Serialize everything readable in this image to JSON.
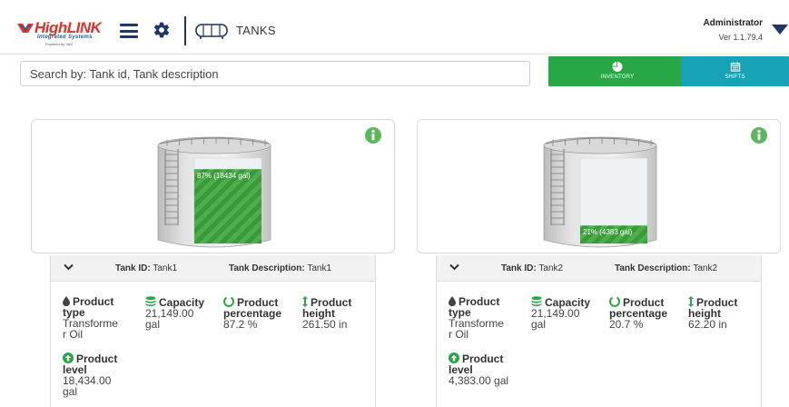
{
  "header": {
    "logo_text": "HighLINK",
    "logo_subtext": "Integrated Systems",
    "logo_powered": "Powered by: BDI",
    "page_title": "TANKS",
    "user_name": "Administrator",
    "version": "Ver 1.1.79.4",
    "icons": [
      "hamburger-icon",
      "gear-icon",
      "tank-icon",
      "chevron-down-icon"
    ],
    "colors": {
      "navy": "#1e3764",
      "logo_red": "#e0312b"
    }
  },
  "search": {
    "placeholder": "Search by: Tank id, Tank description",
    "value": ""
  },
  "buttons": {
    "inventory_label": "INVENTORY",
    "shifts_label": "SHIFTS",
    "inventory_color": "#28a745",
    "shifts_color": "#17a2b8",
    "inventory_icon": "pie-chart-icon",
    "shifts_icon": "calendar-icon"
  },
  "labels": {
    "tank_id": "Tank ID:",
    "tank_description": "Tank Description:",
    "product_type": "Product type",
    "capacity": "Capacity",
    "product_percentage": "Product percentage",
    "product_height": "Product height",
    "product_level": "Product level"
  },
  "tanks": [
    {
      "fill_fraction": 0.87,
      "fill_label": "87% (18434 gal)",
      "tank_id": "Tank1",
      "tank_description": "Tank1",
      "product_type": "Transforme r Oil",
      "capacity": "21,149.00 gal",
      "product_percentage": "87.2 %",
      "product_height": "261.50 in",
      "product_level": "18,434.00 gal"
    },
    {
      "fill_fraction": 0.21,
      "fill_label": "21% (4383 gal)",
      "tank_id": "Tank2",
      "tank_description": "Tank2",
      "product_type": "Transforme r Oil",
      "capacity": "21,149.00 gal",
      "product_percentage": "20.7 %",
      "product_height": "62.20 in",
      "product_level": "4,383.00 gal"
    }
  ]
}
